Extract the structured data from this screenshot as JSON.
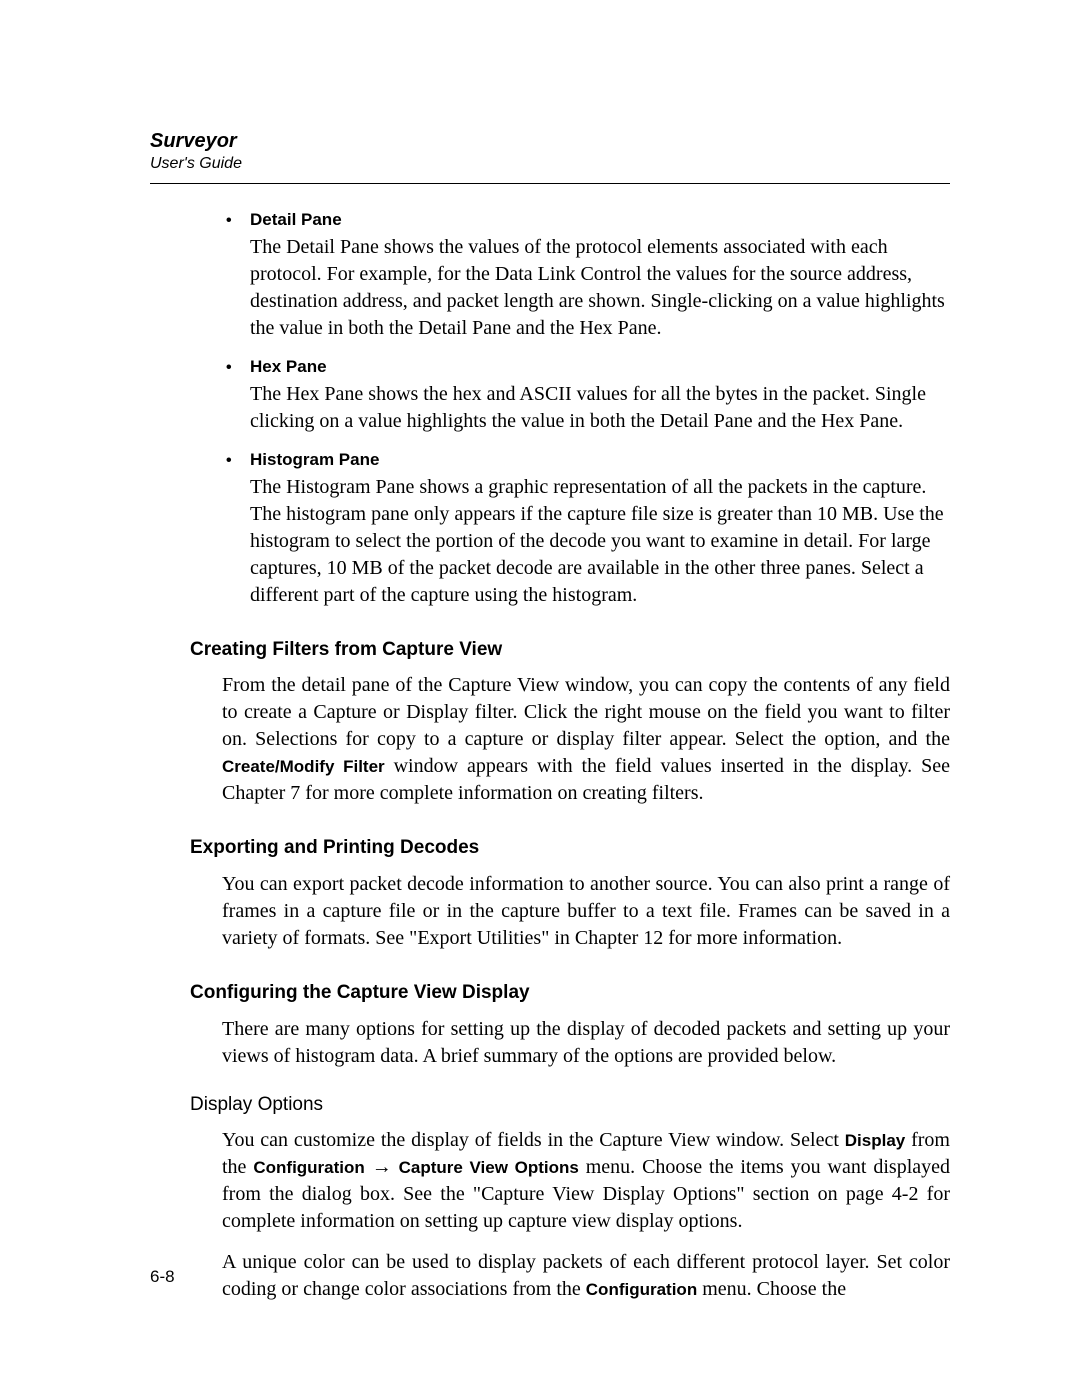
{
  "header": {
    "title": "Surveyor",
    "subtitle": "User's Guide"
  },
  "panes": [
    {
      "title": "Detail Pane",
      "body": "The Detail Pane shows the values of the protocol elements associated with each protocol. For example, for the Data Link Control the values for the source address, destination address, and packet length are shown. Single-clicking on a value highlights the value in both the Detail Pane and the Hex Pane."
    },
    {
      "title": "Hex Pane",
      "body": "The Hex Pane shows the hex and ASCII values for all the bytes in the packet. Single clicking on a value highlights the value in both the Detail Pane and the Hex Pane."
    },
    {
      "title": "Histogram Pane",
      "body": "The Histogram Pane shows a graphic representation of all the packets in the capture. The histogram pane only appears if the capture file size is greater than 10 MB. Use the histogram to select the portion of the decode you want to examine in detail. For large captures, 10 MB of the packet decode are available in the other three panes. Select a different part of the capture using the histogram."
    }
  ],
  "sec1": {
    "heading": "Creating Filters from Capture View",
    "p_before": "From the detail pane of the Capture View window, you can copy the contents of any field to create a Capture or Display filter. Click the right mouse on the field you want to filter on. Selections for copy to a capture or display filter appear. Select the option, and the ",
    "ui": "Create/Modify Filter",
    "p_after": " window appears with the field values inserted in the display. See Chapter 7 for more complete information on creating filters."
  },
  "sec2": {
    "heading": "Exporting and Printing Decodes",
    "p": "You can export packet decode information to another source. You can also print a range of frames in a capture file or in the capture buffer to a text file. Frames can be saved in a variety of formats. See \"Export Utilities\" in Chapter 12 for more information."
  },
  "sec3": {
    "heading": "Configuring the Capture View Display",
    "p": "There are many options for setting up the display of decoded packets and setting up your views of histogram data. A brief summary of the options are provided below."
  },
  "sec4": {
    "heading": "Display Options",
    "p1a": "You can customize the display of fields in the Capture View window. Select ",
    "ui1": "Display",
    "p1b": " from the ",
    "ui2": "Configuration",
    "arrow": " → ",
    "ui3": "Capture View Options",
    "p1c": " menu. Choose the items you want displayed from the dialog box. See the \"Capture View Display Options\" section on page 4-2 for complete information on setting up capture view display options.",
    "p2a": "A unique color can be used to display packets of each different protocol layer. Set color coding or change color associations from the ",
    "ui4": "Configuration",
    "p2b": " menu. Choose the"
  },
  "page_number": "6-8"
}
